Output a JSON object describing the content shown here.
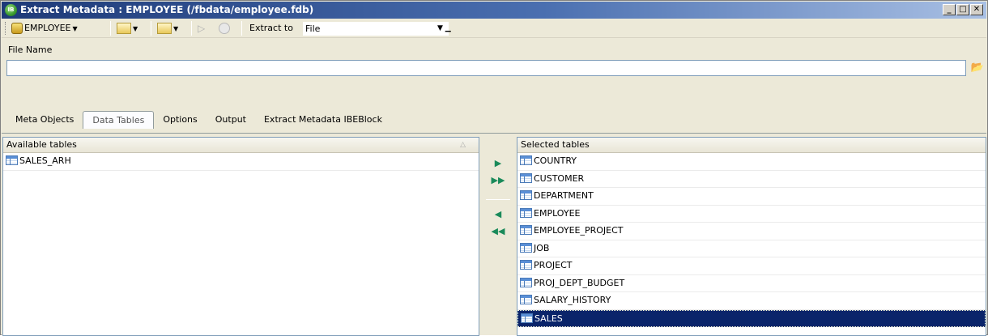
{
  "window": {
    "title": "Extract Metadata : EMPLOYEE (/fbdata/employee.fdb)",
    "title_icon_text": "IB",
    "minimize": "_",
    "maximize": "□",
    "close": "✕"
  },
  "toolbar": {
    "database_label": "EMPLOYEE",
    "extract_to_label": "Extract to",
    "extract_to_value": "File"
  },
  "file_name": {
    "label": "File Name",
    "value": "",
    "browse_icon": "open-folder-icon"
  },
  "tabs": [
    {
      "label": "Meta Objects",
      "active": false
    },
    {
      "label": "Data Tables",
      "active": true
    },
    {
      "label": "Options",
      "active": false
    },
    {
      "label": "Output",
      "active": false
    },
    {
      "label": "Extract Metadata IBEBlock",
      "active": false
    }
  ],
  "available_tables": {
    "header": "Available tables",
    "items": [
      "SALES_ARH"
    ]
  },
  "selected_tables": {
    "header": "Selected tables",
    "items": [
      "COUNTRY",
      "CUSTOMER",
      "DEPARTMENT",
      "EMPLOYEE",
      "EMPLOYEE_PROJECT",
      "JOB",
      "PROJECT",
      "PROJ_DEPT_BUDGET",
      "SALARY_HISTORY",
      "SALES"
    ],
    "selected_item": "SALES"
  },
  "arrows": {
    "add_one": "▶",
    "add_all": "▶▶",
    "remove_one": "◀",
    "remove_all": "◀◀"
  }
}
